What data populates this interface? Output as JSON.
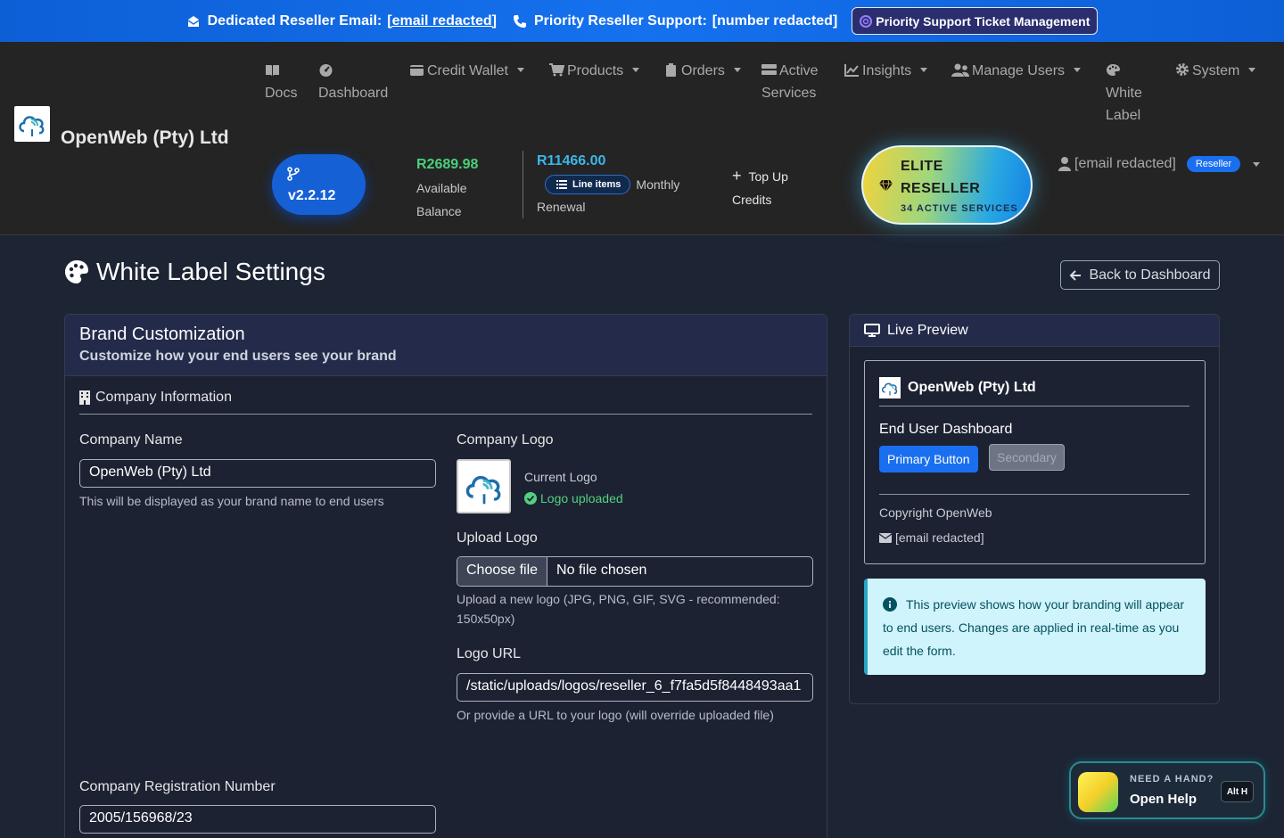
{
  "announcement": {
    "email_label": "Dedicated Reseller Email:",
    "email_value": "[email redacted]",
    "phone_label": "Priority Reseller Support:",
    "phone_value": "[number redacted]",
    "ticket_button": "Priority Support Ticket Management"
  },
  "navbar": {
    "brand_name": "OpenWeb (Pty) Ltd",
    "items": [
      {
        "line1": "Docs",
        "line2": "",
        "icon": "book-icon"
      },
      {
        "line1": "Dashboard",
        "line2": "",
        "icon": "gauge-icon"
      },
      {
        "line1": "Credit Wallet",
        "line2": "",
        "icon": "wallet-icon"
      },
      {
        "line1": "Products",
        "line2": "",
        "icon": "cart-icon"
      },
      {
        "line1": "Orders",
        "line2": "",
        "icon": "clipboard-icon"
      },
      {
        "line1": "Active",
        "line2": "Services",
        "icon": "server-icon"
      },
      {
        "line1": "Insights",
        "line2": "",
        "icon": "chart-line-icon"
      },
      {
        "line1": "Manage Users",
        "line2": "",
        "icon": "users-icon"
      },
      {
        "line1": "White",
        "line2": "Label",
        "icon": "palette-icon"
      },
      {
        "line1": "System",
        "line2": "",
        "icon": "gear-icon"
      }
    ],
    "version": "v2.2.12",
    "balance_amount": "R2689.98",
    "balance_label_1": "Available",
    "balance_label_2": "Balance",
    "renewal_amount": "R11466.00",
    "line_items_label": "Line items",
    "renewal_monthly": "Monthly",
    "renewal_label": "Renewal",
    "topup_line1": "Top Up",
    "topup_line2": "Credits",
    "elite_line1": "ELITE",
    "elite_line2": "RESELLER",
    "elite_services": "34 ACTIVE SERVICES",
    "user_email": "[email redacted]",
    "user_badge": "Reseller"
  },
  "page": {
    "title": "White Label Settings",
    "back_button": "Back to Dashboard"
  },
  "brand_card": {
    "title": "Brand Customization",
    "subtitle": "Customize how your end users see your brand",
    "section": "Company Information",
    "company_name_label": "Company Name",
    "company_name_value": "OpenWeb (Pty) Ltd",
    "company_name_help": "This will be displayed as your brand name to end users",
    "logo_label": "Company Logo",
    "current_logo": "Current Logo",
    "logo_status": "Logo uploaded",
    "upload_label": "Upload Logo",
    "choose_file": "Choose file",
    "no_file": "No file chosen",
    "upload_help_1": "Upload a new logo (JPG, PNG, GIF, SVG - recommended:",
    "upload_help_2": "150x50px)",
    "logo_url_label": "Logo URL",
    "logo_url_value": "/static/uploads/logos/reseller_6_f7fa5d5f8448493aa1",
    "logo_url_help": "Or provide a URL to your logo (will override uploaded file)",
    "reg_label": "Company Registration Number",
    "reg_value": "2005/156968/23"
  },
  "preview_card": {
    "title": "Live Preview",
    "brand": "OpenWeb (Pty) Ltd",
    "dashboard_title": "End User Dashboard",
    "primary_button": "Primary Button",
    "secondary_button": "Secondary",
    "copyright": "Copyright OpenWeb",
    "email": "[email redacted]",
    "info_text": "This preview shows how your branding will appear to end users. Changes are applied in real-time as you edit the form."
  },
  "help_widget": {
    "line1": "NEED A HAND?",
    "line2": "Open Help",
    "shortcut": "Alt H"
  },
  "colors": {
    "topbar": "#1571ee",
    "navbar": "#242424",
    "page_bg": "#1d2434",
    "primary": "#1a6ef0",
    "balance_green": "#49d07a",
    "renewal_blue": "#3cb6e8"
  }
}
